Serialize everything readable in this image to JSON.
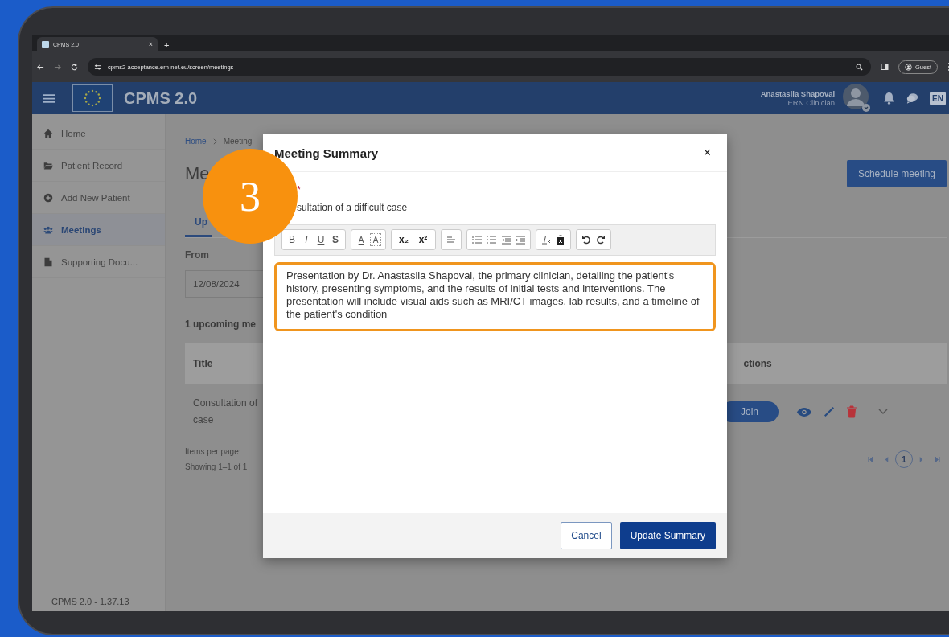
{
  "browser": {
    "tab_title": "CPMS 2.0",
    "tab_close": "×",
    "new_tab": "+",
    "url": "cpms2-acceptance.ern-net.eu/screen/meetings",
    "profile": "Guest"
  },
  "app": {
    "title": "CPMS 2.0",
    "user_name": "Anastasiia Shapoval",
    "user_role": "ERN Clinician",
    "language": "EN"
  },
  "sidebar": {
    "items": [
      {
        "kind": "home",
        "label": "Home",
        "selected": false
      },
      {
        "kind": "folder",
        "label": "Patient Record",
        "selected": false
      },
      {
        "kind": "plus",
        "label": "Add New Patient",
        "selected": false
      },
      {
        "kind": "people",
        "label": "Meetings",
        "selected": true
      },
      {
        "kind": "document",
        "label": "Supporting Docu...",
        "selected": false
      }
    ],
    "version": "CPMS 2.0 - 1.37.13"
  },
  "page": {
    "breadcrumb_home": "Home",
    "breadcrumb_current": "Meeting",
    "title": "Me",
    "schedule_button": "Schedule meeting",
    "tabs": [
      {
        "label": "Up",
        "selected": true
      }
    ],
    "from_label": "From",
    "from_value": "12/08/2024",
    "count_text": "1 upcoming me",
    "table": {
      "columns": [
        "Title",
        "ctions"
      ],
      "rows": [
        {
          "title": "Consultation of case",
          "join": "Join"
        }
      ]
    },
    "items_per_page": "Items per page:",
    "showing": "Showing 1–1 of 1",
    "current_page": "1"
  },
  "modal": {
    "title": "Meeting Summary",
    "close": "×",
    "required_mark": "*",
    "meeting_title": "sultation of a difficult case",
    "toolbar": [
      [
        {
          "kind": "bold",
          "glyph": "B"
        },
        {
          "kind": "italic",
          "glyph": "I"
        },
        {
          "kind": "underline",
          "glyph": "U"
        },
        {
          "kind": "strike",
          "glyph": "S"
        }
      ],
      [
        {
          "kind": "color",
          "glyph": "A"
        },
        {
          "kind": "highlight",
          "glyph": "A"
        }
      ],
      [
        {
          "kind": "subscript",
          "glyph": "x₂"
        },
        {
          "kind": "superscript",
          "glyph": "x²"
        }
      ],
      [
        {
          "kind": "align"
        }
      ],
      [
        {
          "kind": "ol"
        },
        {
          "kind": "ul"
        },
        {
          "kind": "outdent"
        },
        {
          "kind": "indent"
        }
      ],
      [
        {
          "kind": "clear"
        },
        {
          "kind": "delete"
        }
      ],
      [
        {
          "kind": "undo"
        },
        {
          "kind": "redo"
        }
      ]
    ],
    "summary": "Presentation by Dr. Anastasiia Shapoval, the primary clinician, detailing the patient's history, presenting symptoms, and the results of initial tests and interventions. The presentation will include visual aids such as MRI/CT images, lab results, and a timeline of the patient's condition",
    "cancel": "Cancel",
    "submit": "Update Summary"
  },
  "step_badge": "3"
}
